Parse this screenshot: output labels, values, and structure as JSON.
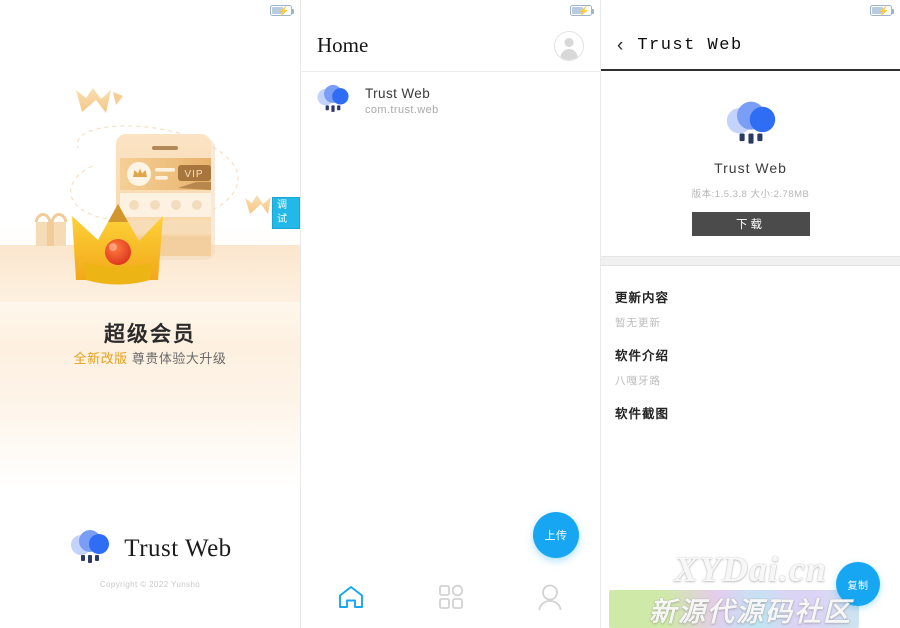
{
  "statusbar": {
    "battery_icon": "battery-charging-icon"
  },
  "splash": {
    "debug_badge": "调试",
    "title": "超级会员",
    "subtitle_highlight": "全新改版",
    "subtitle_rest": "尊贵体验大升级",
    "vip_label": "VIP",
    "brand_name": "Trust Web",
    "copyright": "Copyright © 2022 Yunsho",
    "logo_icon": "cloud-logo-icon",
    "colors": {
      "accent": "#e8a01c",
      "crown": "#f7c948",
      "panel": "#fdf0e0"
    }
  },
  "home": {
    "title": "Home",
    "avatar_icon": "user-avatar-icon",
    "apps": [
      {
        "name": "Trust Web",
        "package": "com.trust.web",
        "icon": "cloud-logo-icon"
      }
    ],
    "fab_label": "上传",
    "tabs": [
      {
        "name": "home",
        "icon": "home-icon",
        "active": true
      },
      {
        "name": "apps",
        "icon": "grid-icon",
        "active": false
      },
      {
        "name": "profile",
        "icon": "person-icon",
        "active": false
      }
    ],
    "colors": {
      "accent": "#17a7f2"
    }
  },
  "detail": {
    "back_icon": "chevron-left-icon",
    "title": "Trust Web",
    "app_icon": "cloud-logo-icon",
    "app_name": "Trust Web",
    "meta": "版本:1.5.3.8 大小:2.78MB",
    "download_label": "下载",
    "sections": [
      {
        "heading": "更新内容",
        "body": "暂无更新"
      },
      {
        "heading": "软件介绍",
        "body": "八嘎牙路"
      },
      {
        "heading": "软件截图",
        "body": ""
      }
    ],
    "fab_label": "复制",
    "colors": {
      "button": "#4b4b4b",
      "accent": "#17a7f2"
    }
  },
  "watermark": {
    "main": "XYDai.cn",
    "sub": "新源代源码社区"
  }
}
